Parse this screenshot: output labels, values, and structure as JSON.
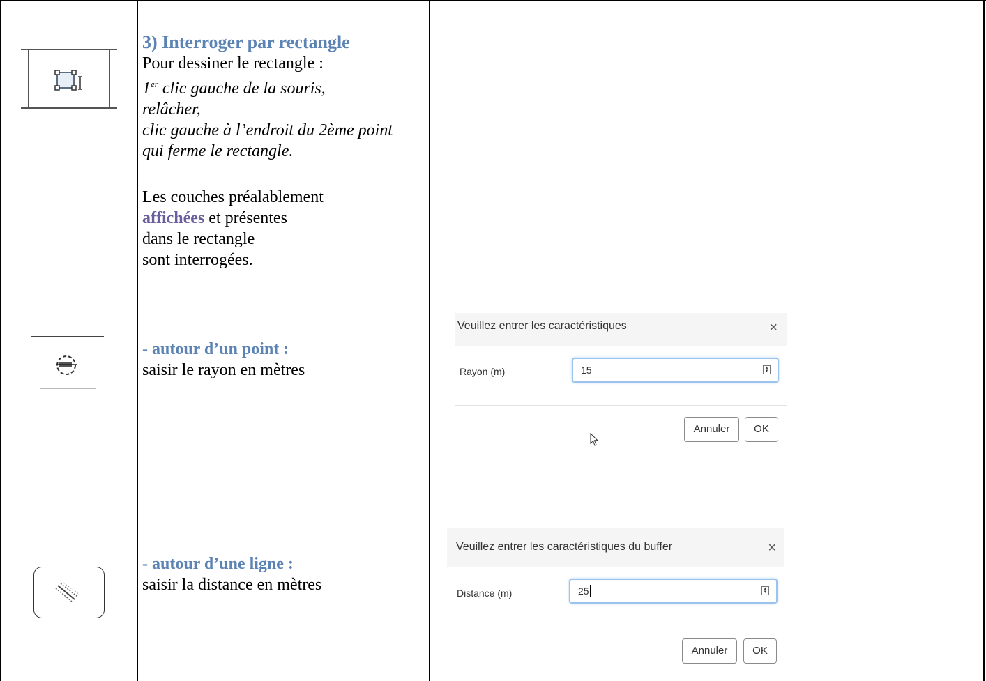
{
  "section": {
    "title": "3) Interroger par rectangle",
    "draw_intro": "Pour dessiner le rectangle :",
    "step1_num": "1",
    "step1_sup": "er",
    "step1_rest": " clic gauche de la souris,",
    "step2": "relâcher,",
    "step3": "clic gauche à l’endroit du 2ème point",
    "step4": "qui ferme le rectangle.",
    "layers_line1": "Les couches préalablement",
    "layers_affichees": "affichées",
    "layers_line2_rest": " et présentes",
    "layers_line3": "dans le rectangle",
    "layers_line4": "sont interrogées."
  },
  "point": {
    "heading": "- autour d’un point :",
    "instruction": "saisir le rayon en mètres"
  },
  "line": {
    "heading": "- autour d’une ligne :",
    "instruction": "saisir la distance en mètres"
  },
  "dialog_point": {
    "title": "Veuillez entrer les caractéristiques",
    "close": "×",
    "label": "Rayon (m)",
    "value": "15",
    "cancel": "Annuler",
    "ok": "OK"
  },
  "dialog_line": {
    "title": "Veuillez entrer les caractéristiques du buffer",
    "close": "×",
    "label": "Distance (m)",
    "value": "25",
    "cancel": "Annuler",
    "ok": "OK"
  },
  "icons": {
    "rectangle_query": "rectangle-select-icon",
    "point_buffer": "point-buffer-icon",
    "line_buffer": "line-buffer-icon",
    "cursor": "mouse-pointer-icon"
  },
  "colors": {
    "heading_blue": "#5b83b4",
    "highlight_purple": "#6a5e9c",
    "input_focus": "#9cc3ee"
  }
}
